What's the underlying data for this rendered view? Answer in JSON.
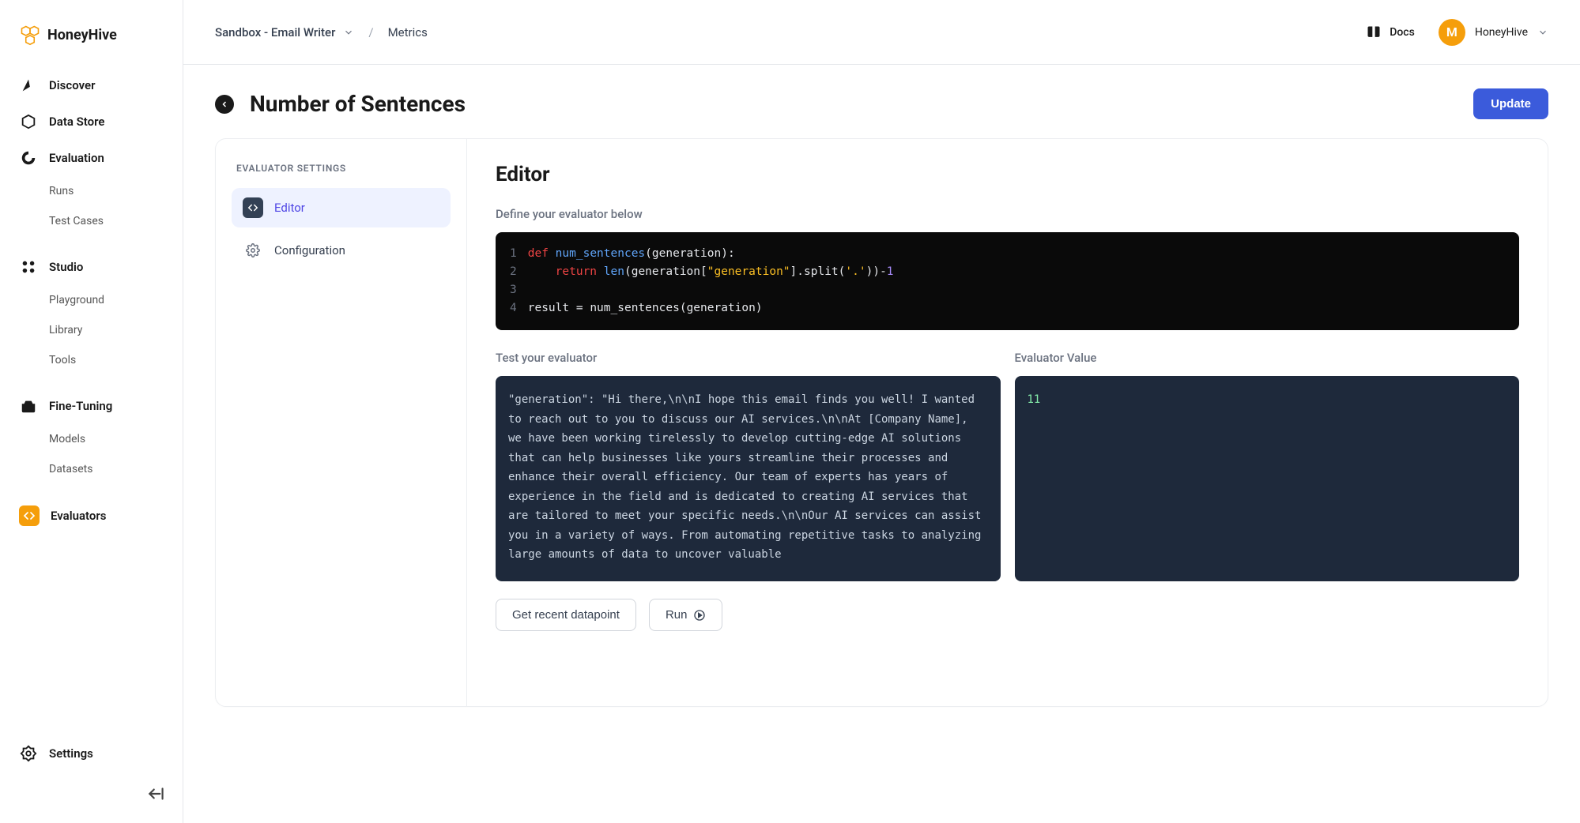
{
  "brand": "HoneyHive",
  "topbar": {
    "project": "Sandbox - Email Writer",
    "crumb": "Metrics",
    "docs_label": "Docs",
    "user_name": "HoneyHive",
    "avatar_initial": "M"
  },
  "sidebar": {
    "items": [
      {
        "id": "discover",
        "label": "Discover",
        "icon": "compass"
      },
      {
        "id": "datastore",
        "label": "Data Store",
        "icon": "cube"
      },
      {
        "id": "evaluation",
        "label": "Evaluation",
        "icon": "donut",
        "children": [
          "Runs",
          "Test Cases"
        ]
      },
      {
        "id": "studio",
        "label": "Studio",
        "icon": "dots",
        "children": [
          "Playground",
          "Library",
          "Tools"
        ]
      },
      {
        "id": "finetuning",
        "label": "Fine-Tuning",
        "icon": "toolbox",
        "children": [
          "Models",
          "Datasets"
        ]
      },
      {
        "id": "evaluators",
        "label": "Evaluators",
        "icon": "code",
        "active": true
      }
    ],
    "settings_label": "Settings"
  },
  "page": {
    "title": "Number of Sentences",
    "update_label": "Update"
  },
  "settings_panel": {
    "title": "EVALUATOR SETTINGS",
    "items": [
      {
        "id": "editor",
        "label": "Editor",
        "active": true
      },
      {
        "id": "configuration",
        "label": "Configuration",
        "active": false
      }
    ]
  },
  "editor": {
    "title": "Editor",
    "helper": "Define your evaluator below",
    "code_lines": [
      "def num_sentences(generation):",
      "    return len(generation[\"generation\"].split('.'))-1",
      "",
      "result = num_sentences(generation)"
    ],
    "test_label": "Test your evaluator",
    "value_label": "Evaluator Value",
    "test_input": "  \"generation\": \"Hi there,\\n\\nI hope this email finds you well! I wanted to reach out to you to discuss our AI services.\\n\\nAt [Company Name], we have been working tirelessly to develop cutting-edge AI solutions that can help businesses like yours streamline their processes and enhance their overall efficiency. Our team of experts has years of experience in the field and is dedicated to creating AI services that are tailored to meet your specific needs.\\n\\nOur AI services can assist you in a variety of ways. From automating repetitive tasks to analyzing large amounts of data to uncover valuable",
    "evaluator_value": "11",
    "get_datapoint_label": "Get recent datapoint",
    "run_label": "Run"
  }
}
